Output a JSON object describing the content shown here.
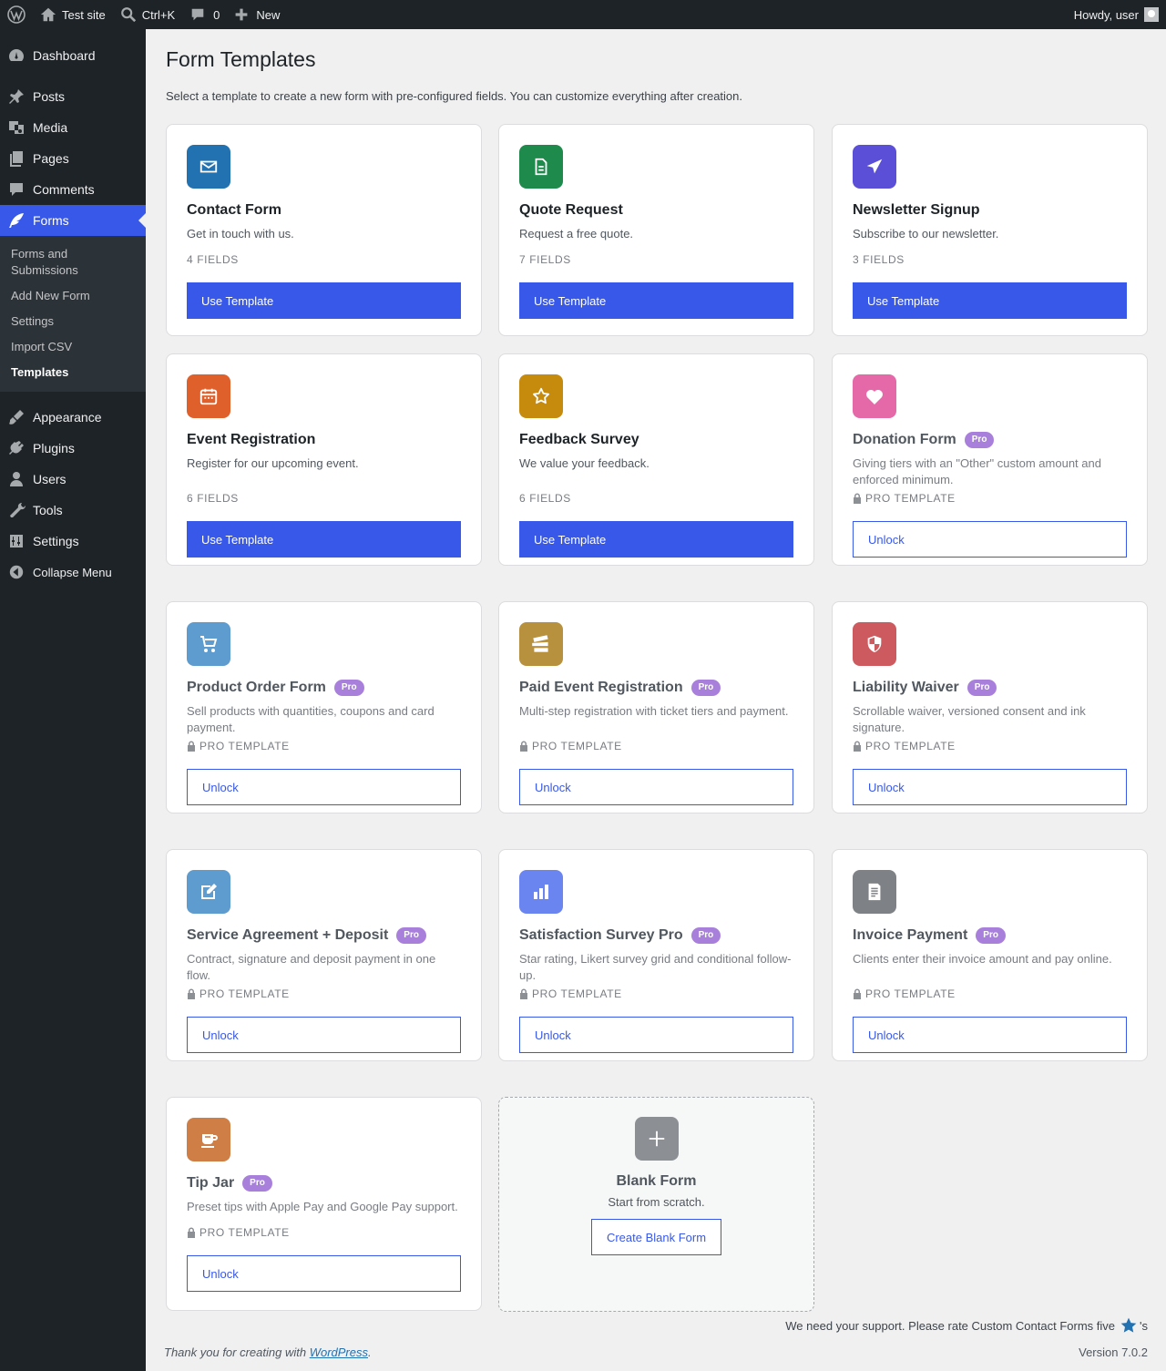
{
  "adminbar": {
    "site_name": "Test site",
    "search_shortcut": "Ctrl+K",
    "comments_count": "0",
    "new_label": "New",
    "howdy": "Howdy, user"
  },
  "sidebar": {
    "items": [
      {
        "label": "Dashboard",
        "icon": "dashboard-icon"
      },
      {
        "label": "Posts",
        "icon": "pin-icon"
      },
      {
        "label": "Media",
        "icon": "media-icon"
      },
      {
        "label": "Pages",
        "icon": "pages-icon"
      },
      {
        "label": "Comments",
        "icon": "comment-icon"
      },
      {
        "label": "Forms",
        "icon": "feather-icon"
      }
    ],
    "submenu": [
      "Forms and Submissions",
      "Add New Form",
      "Settings",
      "Import CSV",
      "Templates"
    ],
    "items2": [
      {
        "label": "Appearance",
        "icon": "brush-icon"
      },
      {
        "label": "Plugins",
        "icon": "plug-icon"
      },
      {
        "label": "Users",
        "icon": "user-icon"
      },
      {
        "label": "Tools",
        "icon": "wrench-icon"
      },
      {
        "label": "Settings",
        "icon": "sliders-icon"
      }
    ],
    "collapse": "Collapse Menu"
  },
  "page": {
    "title": "Form Templates",
    "description": "Select a template to create a new form with pre-configured fields. You can customize everything after creation."
  },
  "templates": [
    {
      "title": "Contact Form",
      "desc": "Get in touch with us.",
      "meta": "4 FIELDS",
      "button": "Use Template",
      "pro": false,
      "color": "#2271b1",
      "icon": "envelope-icon"
    },
    {
      "title": "Quote Request",
      "desc": "Request a free quote.",
      "meta": "7 FIELDS",
      "button": "Use Template",
      "pro": false,
      "color": "#1e8a4c",
      "icon": "document-icon"
    },
    {
      "title": "Newsletter Signup",
      "desc": "Subscribe to our newsletter.",
      "meta": "3 FIELDS",
      "button": "Use Template",
      "pro": false,
      "color": "#5b4fd8",
      "icon": "paper-plane-icon"
    },
    {
      "title": "Event Registration",
      "desc": "Register for our upcoming event.",
      "meta": "6 FIELDS",
      "button": "Use Template",
      "pro": false,
      "color": "#e0602b",
      "icon": "calendar-icon"
    },
    {
      "title": "Feedback Survey",
      "desc": "We value your feedback.",
      "meta": "6 FIELDS",
      "button": "Use Template",
      "pro": false,
      "color": "#c68a0d",
      "icon": "star-icon"
    },
    {
      "title": "Donation Form",
      "badge": "Pro",
      "desc": "Giving tiers with an \"Other\" custom amount and enforced minimum.",
      "meta": "PRO TEMPLATE",
      "button": "Unlock",
      "pro": true,
      "color": "#e568a8",
      "icon": "heart-icon"
    },
    {
      "title": "Product Order Form",
      "badge": "Pro",
      "desc": "Sell products with quantities, coupons and card payment.",
      "meta": "PRO TEMPLATE",
      "button": "Unlock",
      "pro": true,
      "color": "#5e9bce",
      "icon": "cart-icon"
    },
    {
      "title": "Paid Event Registration",
      "badge": "Pro",
      "desc": "Multi-step registration with ticket tiers and payment.",
      "meta": "PRO TEMPLATE",
      "button": "Unlock",
      "pro": true,
      "color": "#b8913e",
      "icon": "tickets-icon"
    },
    {
      "title": "Liability Waiver",
      "badge": "Pro",
      "desc": "Scrollable waiver, versioned consent and ink signature.",
      "meta": "PRO TEMPLATE",
      "button": "Unlock",
      "pro": true,
      "color": "#cc5a5e",
      "icon": "shield-icon"
    },
    {
      "title": "Service Agreement + Deposit",
      "badge": "Pro",
      "desc": "Contract, signature and deposit payment in one flow.",
      "meta": "PRO TEMPLATE",
      "button": "Unlock",
      "pro": true,
      "color": "#5e9bce",
      "icon": "edit-document-icon"
    },
    {
      "title": "Satisfaction Survey Pro",
      "badge": "Pro",
      "desc": "Star rating, Likert survey grid and conditional follow-up.",
      "meta": "PRO TEMPLATE",
      "button": "Unlock",
      "pro": true,
      "color": "#6b85f0",
      "icon": "bar-chart-icon"
    },
    {
      "title": "Invoice Payment",
      "badge": "Pro",
      "desc": "Clients enter their invoice amount and pay online.",
      "meta": "PRO TEMPLATE",
      "button": "Unlock",
      "pro": true,
      "color": "#7e8185",
      "icon": "invoice-icon"
    },
    {
      "title": "Tip Jar",
      "badge": "Pro",
      "desc": "Preset tips with Apple Pay and Google Pay support.",
      "meta": "PRO TEMPLATE",
      "button": "Unlock",
      "pro": true,
      "color": "#cf7f45",
      "icon": "coffee-cup-icon"
    }
  ],
  "blank": {
    "title": "Blank Form",
    "desc": "Start from scratch.",
    "button": "Create Blank Form"
  },
  "footer": {
    "support_text": "We need your support. Please rate Custom Contact Forms five",
    "support_suffix": "'s",
    "thanks_prefix": "Thank you for creating with ",
    "thanks_link": "WordPress",
    "thanks_suffix": ".",
    "version": "Version 7.0.2"
  }
}
